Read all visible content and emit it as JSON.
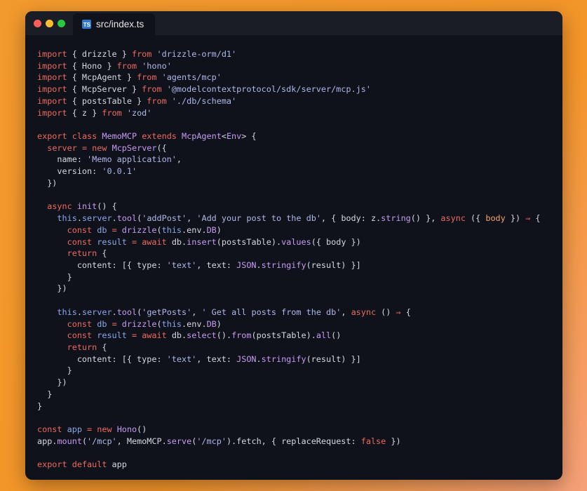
{
  "window": {
    "tab_label": "src/index.ts",
    "tab_icon": "typescript-icon",
    "tab_icon_text": "TS",
    "traffic_lights": [
      "close",
      "minimize",
      "maximize"
    ]
  },
  "colors": {
    "background": "#f39a2e",
    "editor_bg": "#10121b",
    "keyword": "#ec6a5e",
    "string": "#b0b8e8",
    "function": "#c59cf2",
    "class": "#c59cf2",
    "type": "#c59cf2",
    "member": "#8aa8ea",
    "param": "#f4a56a",
    "operator": "#ec6a5e",
    "plain": "#d6d8e0"
  },
  "code_lines": [
    [
      [
        "kw",
        "import"
      ],
      [
        "pl",
        " { drizzle } "
      ],
      [
        "kw",
        "from"
      ],
      [
        "pl",
        " "
      ],
      [
        "st",
        "'drizzle-orm/d1'"
      ]
    ],
    [
      [
        "kw",
        "import"
      ],
      [
        "pl",
        " { Hono } "
      ],
      [
        "kw",
        "from"
      ],
      [
        "pl",
        " "
      ],
      [
        "st",
        "'hono'"
      ]
    ],
    [
      [
        "kw",
        "import"
      ],
      [
        "pl",
        " { McpAgent } "
      ],
      [
        "kw",
        "from"
      ],
      [
        "pl",
        " "
      ],
      [
        "st",
        "'agents/mcp'"
      ]
    ],
    [
      [
        "kw",
        "import"
      ],
      [
        "pl",
        " { McpServer } "
      ],
      [
        "kw",
        "from"
      ],
      [
        "pl",
        " "
      ],
      [
        "st",
        "'@modelcontextprotocol/sdk/server/mcp.js'"
      ]
    ],
    [
      [
        "kw",
        "import"
      ],
      [
        "pl",
        " { postsTable } "
      ],
      [
        "kw",
        "from"
      ],
      [
        "pl",
        " "
      ],
      [
        "st",
        "'./db/schema'"
      ]
    ],
    [
      [
        "kw",
        "import"
      ],
      [
        "pl",
        " { z } "
      ],
      [
        "kw",
        "from"
      ],
      [
        "pl",
        " "
      ],
      [
        "st",
        "'zod'"
      ]
    ],
    [],
    [
      [
        "kw",
        "export"
      ],
      [
        "pl",
        " "
      ],
      [
        "kw",
        "class"
      ],
      [
        "pl",
        " "
      ],
      [
        "cl",
        "MemoMCP"
      ],
      [
        "pl",
        " "
      ],
      [
        "kw",
        "extends"
      ],
      [
        "pl",
        " "
      ],
      [
        "cl",
        "McpAgent"
      ],
      [
        "pl",
        "<"
      ],
      [
        "cl",
        "Env"
      ],
      [
        "pl",
        "> {"
      ]
    ],
    [
      [
        "pl",
        "  "
      ],
      [
        "kw",
        "server"
      ],
      [
        "pl",
        " "
      ],
      [
        "op",
        "="
      ],
      [
        "pl",
        " "
      ],
      [
        "kw",
        "new"
      ],
      [
        "pl",
        " "
      ],
      [
        "cl",
        "McpServer"
      ],
      [
        "pl",
        "({"
      ]
    ],
    [
      [
        "pl",
        "    name: "
      ],
      [
        "st",
        "'Memo application'"
      ],
      [
        "pl",
        ","
      ]
    ],
    [
      [
        "pl",
        "    version: "
      ],
      [
        "st",
        "'0.0.1'"
      ]
    ],
    [
      [
        "pl",
        "  })"
      ]
    ],
    [],
    [
      [
        "pl",
        "  "
      ],
      [
        "kw",
        "async"
      ],
      [
        "pl",
        " "
      ],
      [
        "fn",
        "init"
      ],
      [
        "pl",
        "() {"
      ]
    ],
    [
      [
        "pl",
        "    "
      ],
      [
        "mb",
        "this"
      ],
      [
        "pl",
        "."
      ],
      [
        "mb",
        "server"
      ],
      [
        "pl",
        "."
      ],
      [
        "fn",
        "tool"
      ],
      [
        "pl",
        "("
      ],
      [
        "st",
        "'addPost'"
      ],
      [
        "pl",
        ", "
      ],
      [
        "st",
        "'Add your post to the db'"
      ],
      [
        "pl",
        ", { body: z."
      ],
      [
        "fn",
        "string"
      ],
      [
        "pl",
        "() }, "
      ],
      [
        "kw",
        "async"
      ],
      [
        "pl",
        " ({ "
      ],
      [
        "pa",
        "body"
      ],
      [
        "pl",
        " }) "
      ],
      [
        "op",
        "⇒"
      ],
      [
        "pl",
        " {"
      ]
    ],
    [
      [
        "pl",
        "      "
      ],
      [
        "kw",
        "const"
      ],
      [
        "pl",
        " "
      ],
      [
        "mb",
        "db"
      ],
      [
        "pl",
        " "
      ],
      [
        "op",
        "="
      ],
      [
        "pl",
        " "
      ],
      [
        "fn",
        "drizzle"
      ],
      [
        "pl",
        "("
      ],
      [
        "mb",
        "this"
      ],
      [
        "pl",
        ".env."
      ],
      [
        "cl",
        "DB"
      ],
      [
        "pl",
        ")"
      ]
    ],
    [
      [
        "pl",
        "      "
      ],
      [
        "kw",
        "const"
      ],
      [
        "pl",
        " "
      ],
      [
        "mb",
        "result"
      ],
      [
        "pl",
        " "
      ],
      [
        "op",
        "="
      ],
      [
        "pl",
        " "
      ],
      [
        "kw",
        "await"
      ],
      [
        "pl",
        " db."
      ],
      [
        "fn",
        "insert"
      ],
      [
        "pl",
        "(postsTable)."
      ],
      [
        "fn",
        "values"
      ],
      [
        "pl",
        "({ body })"
      ]
    ],
    [
      [
        "pl",
        "      "
      ],
      [
        "kw",
        "return"
      ],
      [
        "pl",
        " {"
      ]
    ],
    [
      [
        "pl",
        "        content: [{ type: "
      ],
      [
        "st",
        "'text'"
      ],
      [
        "pl",
        ", text: "
      ],
      [
        "cl",
        "JSON"
      ],
      [
        "pl",
        "."
      ],
      [
        "fn",
        "stringify"
      ],
      [
        "pl",
        "(result) }]"
      ]
    ],
    [
      [
        "pl",
        "      }"
      ]
    ],
    [
      [
        "pl",
        "    })"
      ]
    ],
    [],
    [
      [
        "pl",
        "    "
      ],
      [
        "mb",
        "this"
      ],
      [
        "pl",
        "."
      ],
      [
        "mb",
        "server"
      ],
      [
        "pl",
        "."
      ],
      [
        "fn",
        "tool"
      ],
      [
        "pl",
        "("
      ],
      [
        "st",
        "'getPosts'"
      ],
      [
        "pl",
        ", "
      ],
      [
        "st",
        "' Get all posts from the db'"
      ],
      [
        "pl",
        ", "
      ],
      [
        "kw",
        "async"
      ],
      [
        "pl",
        " () "
      ],
      [
        "op",
        "⇒"
      ],
      [
        "pl",
        " {"
      ]
    ],
    [
      [
        "pl",
        "      "
      ],
      [
        "kw",
        "const"
      ],
      [
        "pl",
        " "
      ],
      [
        "mb",
        "db"
      ],
      [
        "pl",
        " "
      ],
      [
        "op",
        "="
      ],
      [
        "pl",
        " "
      ],
      [
        "fn",
        "drizzle"
      ],
      [
        "pl",
        "("
      ],
      [
        "mb",
        "this"
      ],
      [
        "pl",
        ".env."
      ],
      [
        "cl",
        "DB"
      ],
      [
        "pl",
        ")"
      ]
    ],
    [
      [
        "pl",
        "      "
      ],
      [
        "kw",
        "const"
      ],
      [
        "pl",
        " "
      ],
      [
        "mb",
        "result"
      ],
      [
        "pl",
        " "
      ],
      [
        "op",
        "="
      ],
      [
        "pl",
        " "
      ],
      [
        "kw",
        "await"
      ],
      [
        "pl",
        " db."
      ],
      [
        "fn",
        "select"
      ],
      [
        "pl",
        "()."
      ],
      [
        "fn",
        "from"
      ],
      [
        "pl",
        "(postsTable)."
      ],
      [
        "fn",
        "all"
      ],
      [
        "pl",
        "()"
      ]
    ],
    [
      [
        "pl",
        "      "
      ],
      [
        "kw",
        "return"
      ],
      [
        "pl",
        " {"
      ]
    ],
    [
      [
        "pl",
        "        content: [{ type: "
      ],
      [
        "st",
        "'text'"
      ],
      [
        "pl",
        ", text: "
      ],
      [
        "cl",
        "JSON"
      ],
      [
        "pl",
        "."
      ],
      [
        "fn",
        "stringify"
      ],
      [
        "pl",
        "(result) }]"
      ]
    ],
    [
      [
        "pl",
        "      }"
      ]
    ],
    [
      [
        "pl",
        "    })"
      ]
    ],
    [
      [
        "pl",
        "  }"
      ]
    ],
    [
      [
        "pl",
        "}"
      ]
    ],
    [],
    [
      [
        "kw",
        "const"
      ],
      [
        "pl",
        " "
      ],
      [
        "mb",
        "app"
      ],
      [
        "pl",
        " "
      ],
      [
        "op",
        "="
      ],
      [
        "pl",
        " "
      ],
      [
        "kw",
        "new"
      ],
      [
        "pl",
        " "
      ],
      [
        "cl",
        "Hono"
      ],
      [
        "pl",
        "()"
      ]
    ],
    [
      [
        "pl",
        "app."
      ],
      [
        "fn",
        "mount"
      ],
      [
        "pl",
        "("
      ],
      [
        "st",
        "'/mcp'"
      ],
      [
        "pl",
        ", MemoMCP."
      ],
      [
        "fn",
        "serve"
      ],
      [
        "pl",
        "("
      ],
      [
        "st",
        "'/mcp'"
      ],
      [
        "pl",
        ").fetch, { replaceRequest: "
      ],
      [
        "kw",
        "false"
      ],
      [
        "pl",
        " })"
      ]
    ],
    [],
    [
      [
        "kw",
        "export"
      ],
      [
        "pl",
        " "
      ],
      [
        "kw",
        "default"
      ],
      [
        "pl",
        " app"
      ]
    ]
  ]
}
